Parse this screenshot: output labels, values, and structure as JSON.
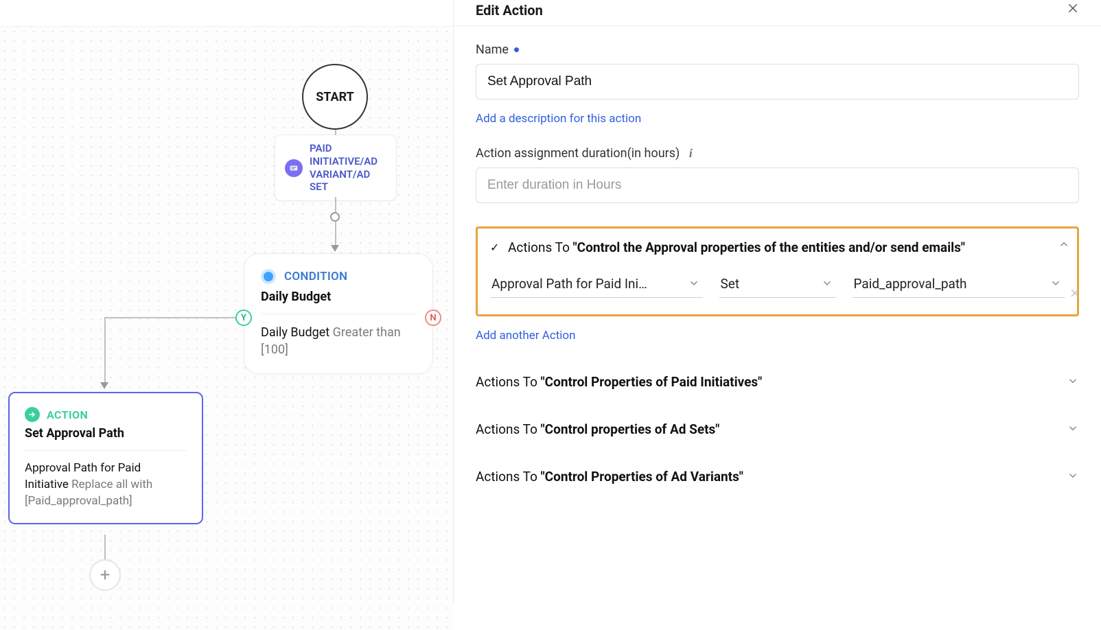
{
  "panel": {
    "title": "Edit Action",
    "name_label": "Name",
    "name_value": "Set Approval Path",
    "add_desc_link": "Add a description for this action",
    "duration_label": "Action assignment duration(in hours)",
    "duration_placeholder": "Enter duration in Hours",
    "add_another_action": "Add another Action"
  },
  "hl": {
    "prefix": "Actions To ",
    "quoted": "\"Control the Approval properties of the entities and/or send emails\"",
    "select1": "Approval Path for Paid Ini…",
    "select2": "Set",
    "select3": "Paid_approval_path"
  },
  "sections": {
    "s1_prefix": "Actions To ",
    "s1_quoted": "\"Control Properties of Paid Initiatives\"",
    "s2_prefix": "Actions To ",
    "s2_quoted": "\"Control properties of Ad Sets\"",
    "s3_prefix": "Actions To ",
    "s3_quoted": "\"Control Properties of Ad Variants\""
  },
  "flow": {
    "start": "START",
    "entity": "PAID INITIATIVE/AD VARIANT/AD SET",
    "cond_label": "CONDITION",
    "cond_title": "Daily Budget",
    "cond_field": "Daily Budget",
    "cond_op": "Greater than [100]",
    "yes": "Y",
    "no": "N",
    "action_label": "ACTION",
    "action_title": "Set Approval Path",
    "action_field": "Approval Path for Paid Initiative",
    "action_op": "Replace all with [Paid_approval_path]"
  }
}
